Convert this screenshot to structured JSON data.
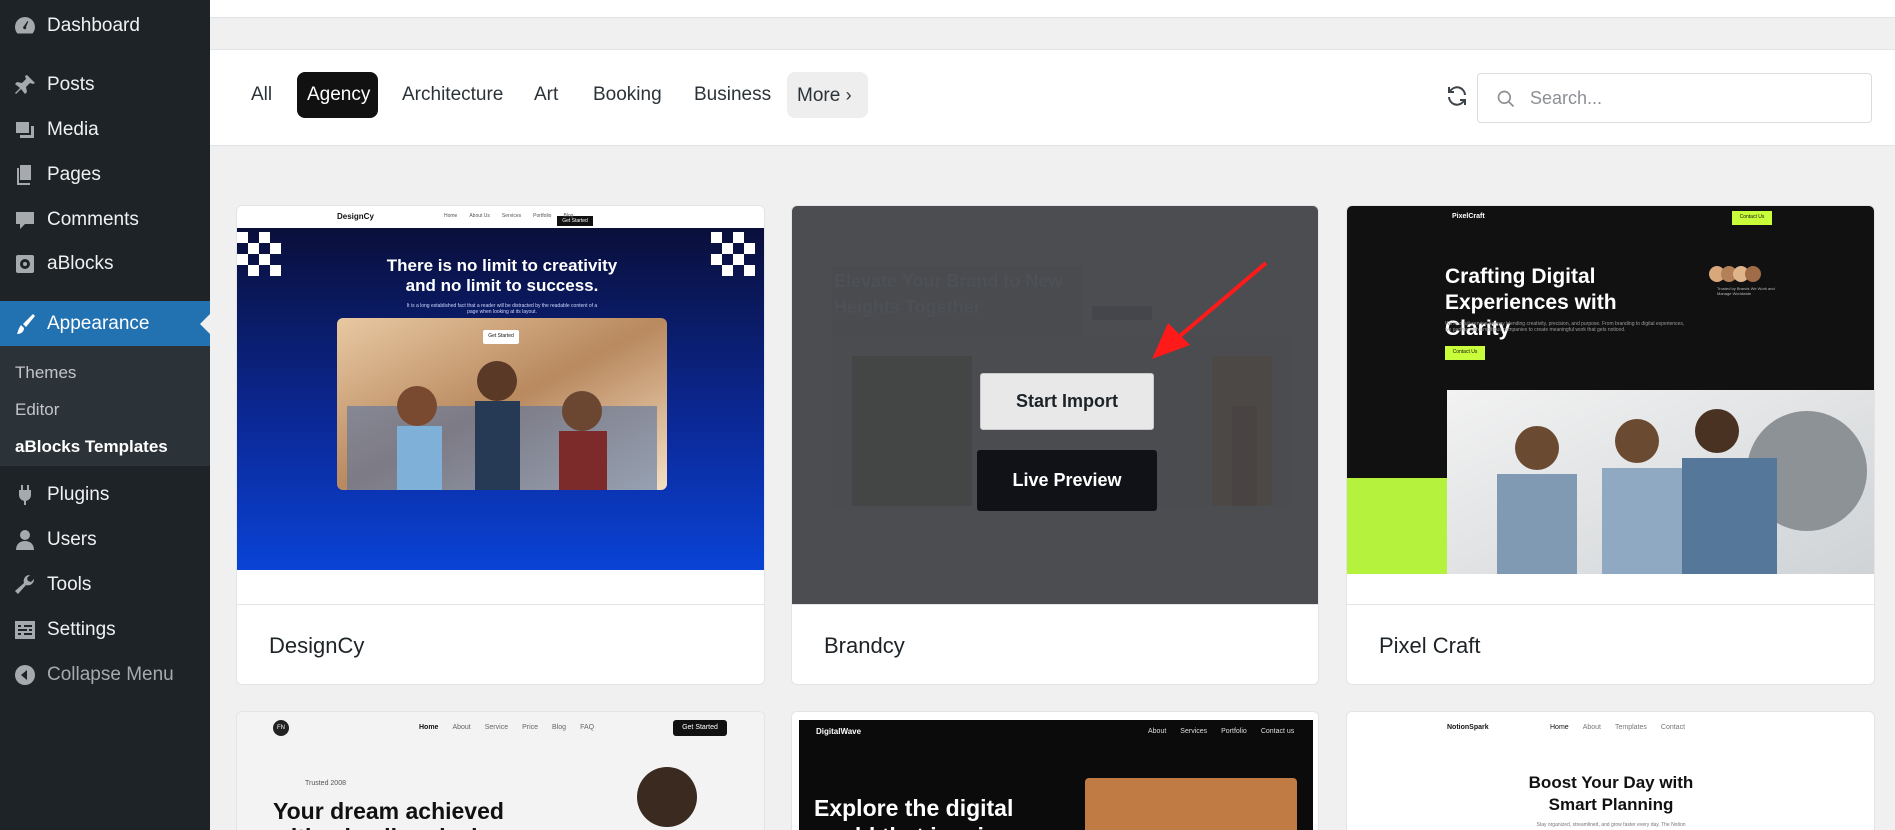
{
  "sidebar": {
    "items": [
      {
        "label": "Dashboard",
        "icon": "dashboard-icon"
      },
      {
        "label": "Posts",
        "icon": "pin-icon"
      },
      {
        "label": "Media",
        "icon": "media-icon"
      },
      {
        "label": "Pages",
        "icon": "pages-icon"
      },
      {
        "label": "Comments",
        "icon": "comment-icon"
      },
      {
        "label": "aBlocks",
        "icon": "ablocks-icon"
      },
      {
        "label": "Appearance",
        "icon": "brush-icon"
      },
      {
        "label": "Plugins",
        "icon": "plugin-icon"
      },
      {
        "label": "Users",
        "icon": "user-icon"
      },
      {
        "label": "Tools",
        "icon": "wrench-icon"
      },
      {
        "label": "Settings",
        "icon": "settings-icon"
      },
      {
        "label": "Collapse Menu",
        "icon": "collapse-icon"
      }
    ],
    "submenu": [
      "Themes",
      "Editor",
      "aBlocks Templates"
    ]
  },
  "filters": {
    "categories": [
      "All",
      "Agency",
      "Architecture",
      "Art",
      "Booking",
      "Business",
      "More"
    ],
    "active": "Agency",
    "search_placeholder": "Search..."
  },
  "templates": [
    {
      "name": "DesignCy",
      "preview": {
        "logo": "DesignCy",
        "nav": [
          "Home",
          "About Us",
          "Services",
          "Portfolio",
          "Blog"
        ],
        "cta": "Get Started",
        "headline": "There is no limit to creativity and no limit to success.",
        "sub": "It is a long established fact that a reader will be distracted by the readable content of a page when looking at its layout.",
        "button": "Get Started"
      }
    },
    {
      "name": "Brandcy",
      "preview": {
        "headline": "Elevate Your Brand to New Heights Together"
      },
      "overlay": {
        "start_import": "Start Import",
        "live_preview": "Live Preview"
      }
    },
    {
      "name": "Pixel Craft",
      "preview": {
        "logo": "PixelCraft",
        "cta": "Contact Us",
        "headline": "Crafting Digital Experiences with Clarity",
        "sub": "We're a full-service agency blending creativity, precision, and purpose. From branding to digital experiences, we partner with ambitious companies to create meaningful work that gets noticed.",
        "button": "Contact Us",
        "trust": "Trusted by Brands We Work and Manage Worldwide"
      }
    }
  ],
  "row2": [
    {
      "logo": "FN",
      "nav": [
        "Home",
        "About",
        "Service",
        "Price",
        "Blog",
        "FAQ"
      ],
      "cta": "Get Started",
      "tag": "Trusted 2008",
      "headline": "Your dream achieved with a leading design"
    },
    {
      "logo": "DigitalWave",
      "nav": [
        "About",
        "Services",
        "Portfolio",
        "Contact us"
      ],
      "headline": "Explore the digital world that inspires"
    },
    {
      "logo": "NotionSpark",
      "nav": [
        "Home",
        "About",
        "Templates",
        "Contact"
      ],
      "headline": "Boost Your Day with Smart Planning",
      "sub": "Stay organized, streamlined, and grow faster every day. The Notion"
    }
  ]
}
